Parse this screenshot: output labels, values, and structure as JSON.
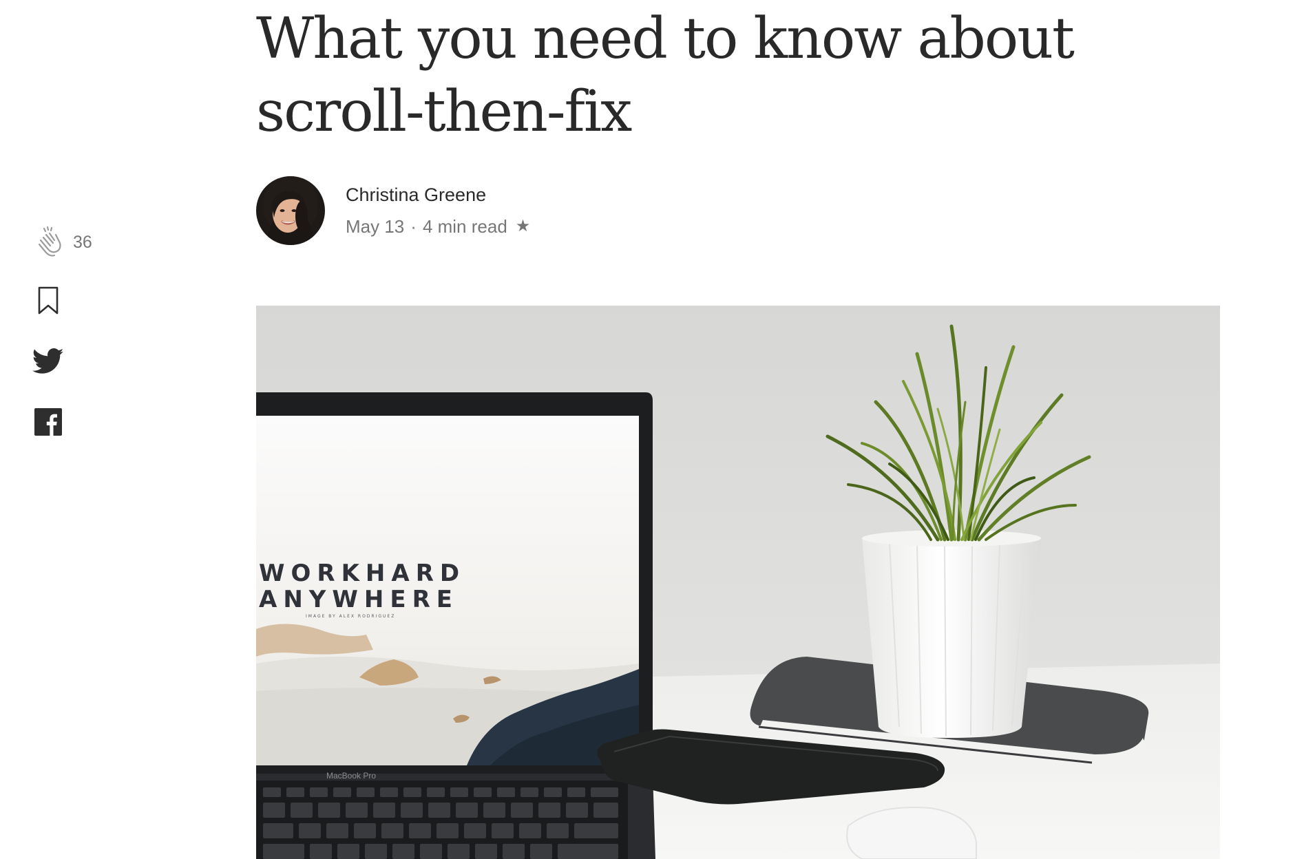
{
  "article": {
    "title": "What you need to know about scroll-then-fix",
    "author": "Christina Greene",
    "date": "May 13",
    "separator": "·",
    "read_time": "4 min read",
    "member_star": "★"
  },
  "share_rail": {
    "clap_count": "36",
    "icons": [
      "clap-icon",
      "bookmark-icon",
      "twitter-icon",
      "facebook-icon"
    ]
  },
  "hero": {
    "screen_line_1": "WORKHARD",
    "screen_line_2": "ANYWHERE",
    "screen_credit": "IMAGE BY ALEX RODRIGUEZ",
    "laptop_brand": "MacBook Pro"
  },
  "colors": {
    "text_primary": "#292929",
    "text_secondary": "#757575",
    "icon_gray": "#6b6b6b"
  }
}
